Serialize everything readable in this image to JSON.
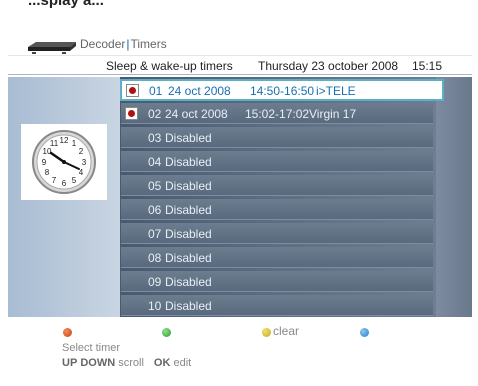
{
  "top_clip_text": "...splay a...",
  "breadcrumb": {
    "part1": "Decoder",
    "separator": "|",
    "part2": "Timers"
  },
  "header": {
    "title": "Sleep & wake-up timers",
    "date": "Thursday 23 october 2008",
    "time": "15:15"
  },
  "timers": [
    {
      "num": "01",
      "date": "24 oct 2008",
      "time": "14:50-16:50",
      "channel": "i>TELE",
      "recording": true,
      "selected": true
    },
    {
      "num": "02",
      "date": "24 oct 2008",
      "time": "15:02-17:02",
      "channel": "Virgin 17",
      "recording": true,
      "selected": false
    },
    {
      "num": "03",
      "label": "Disabled"
    },
    {
      "num": "04",
      "label": "Disabled"
    },
    {
      "num": "05",
      "label": "Disabled"
    },
    {
      "num": "06",
      "label": "Disabled"
    },
    {
      "num": "07",
      "label": "Disabled"
    },
    {
      "num": "08",
      "label": "Disabled"
    },
    {
      "num": "09",
      "label": "Disabled"
    },
    {
      "num": "10",
      "label": "Disabled"
    }
  ],
  "footer": {
    "yellow_label": "clear",
    "red_hint": "Select timer",
    "nav_up": "UP",
    "nav_down": "DOWN",
    "nav_scroll": "scroll",
    "nav_ok": "OK",
    "nav_edit": "edit"
  },
  "colors": {
    "accent": "#5ab0c6",
    "selected_text": "#1a6fb0",
    "rec_dot": "#b01010"
  },
  "icons": {
    "device": "set-top-box-icon",
    "clock": "wall-clock-icon"
  }
}
